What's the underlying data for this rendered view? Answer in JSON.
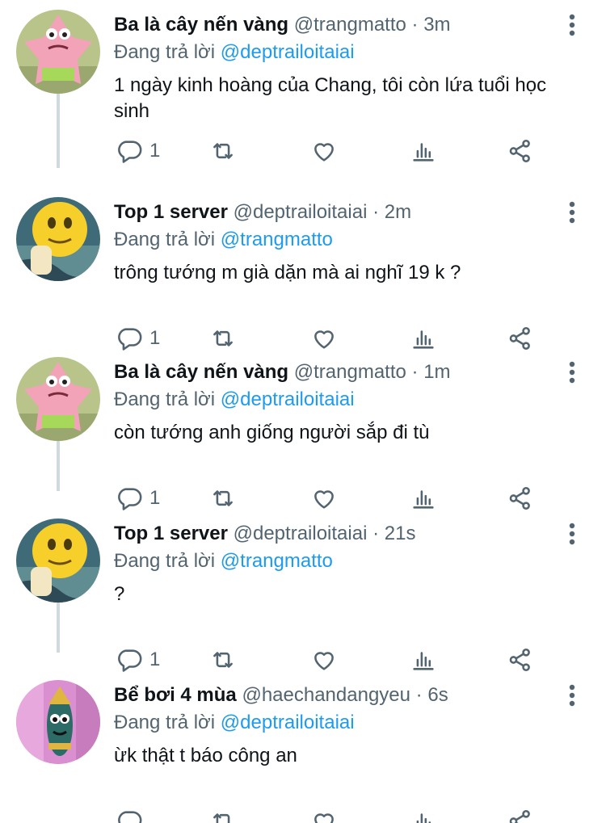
{
  "tweets": [
    {
      "name": "Ba là cây nến vàng",
      "handle": "@trangmatto",
      "separator": "·",
      "time": "3m",
      "reply_prefix": "Đang trả lời",
      "reply_to": "@deptrailoitaiai",
      "text": "1 ngày kinh hoàng của Chang, tôi còn lứa tuổi học sinh",
      "reply_count": "1",
      "avatar": "patrick-star-avatar"
    },
    {
      "name": "Top 1 server",
      "handle": "@deptrailoitaiai",
      "separator": "·",
      "time": "2m",
      "reply_prefix": "Đang trả lời",
      "reply_to": "@trangmatto",
      "text": "trông tướng m già dặn mà ai nghĩ 19 k ?",
      "reply_count": "1",
      "avatar": "emoji-avatar"
    },
    {
      "name": "Ba là cây nến vàng",
      "handle": "@trangmatto",
      "separator": "·",
      "time": "1m",
      "reply_prefix": "Đang trả lời",
      "reply_to": "@deptrailoitaiai",
      "text": "còn tướng anh giống người sắp đi tù",
      "reply_count": "1",
      "avatar": "patrick-star-avatar"
    },
    {
      "name": "Top 1 server",
      "handle": "@deptrailoitaiai",
      "separator": "·",
      "time": "21s",
      "reply_prefix": "Đang trả lời",
      "reply_to": "@trangmatto",
      "text": "?",
      "reply_count": "1",
      "avatar": "emoji-avatar"
    },
    {
      "name": "Bể bơi 4 mùa",
      "handle": "@haechandangyeu",
      "separator": "·",
      "time": "6s",
      "reply_prefix": "Đang trả lời",
      "reply_to": "@deptrailoitaiai",
      "text": "ừk thật t báo công an",
      "reply_count": "",
      "avatar": "fish-avatar"
    }
  ],
  "colors": {
    "text": "#0f1419",
    "secondary": "#536471",
    "mention": "#1d9bf0",
    "thread_line": "#cfd9de"
  }
}
